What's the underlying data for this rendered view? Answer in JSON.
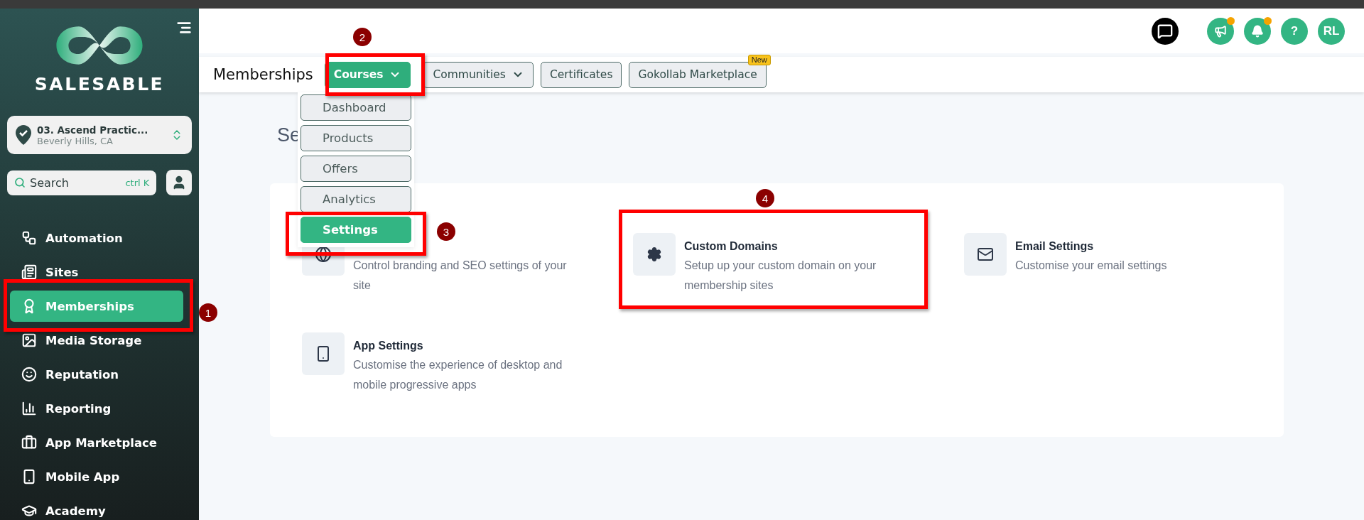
{
  "sidebar": {
    "logo": "SALESABLE",
    "location": {
      "name": "03. Ascend Practic...",
      "city": "Beverly Hills, CA"
    },
    "search": {
      "placeholder": "Search",
      "shortcut": "ctrl K"
    },
    "items": [
      {
        "label": "Automation",
        "selected": false
      },
      {
        "label": "Sites",
        "selected": false
      },
      {
        "label": "Memberships",
        "selected": true
      },
      {
        "label": "Media Storage",
        "selected": false
      },
      {
        "label": "Reputation",
        "selected": false
      },
      {
        "label": "Reporting",
        "selected": false
      },
      {
        "label": "App Marketplace",
        "selected": false
      },
      {
        "label": "Mobile App",
        "selected": false
      },
      {
        "label": "Academy",
        "selected": false
      }
    ]
  },
  "header": {
    "actions": [
      {
        "kind": "chat",
        "badge": false
      },
      {
        "kind": "megaphone",
        "badge": true
      },
      {
        "kind": "bell",
        "badge": true
      },
      {
        "kind": "help",
        "label": "?",
        "badge": false
      },
      {
        "kind": "avatar",
        "label": "RL",
        "badge": false
      }
    ]
  },
  "subnav": {
    "title": "Memberships",
    "tabs": [
      {
        "label": "Courses",
        "selected": true,
        "dropdown": true
      },
      {
        "label": "Communities",
        "selected": false,
        "dropdown": true
      },
      {
        "label": "Certificates",
        "selected": false,
        "dropdown": false
      },
      {
        "label": "Gokollab Marketplace",
        "selected": false,
        "dropdown": false,
        "badge": "New"
      }
    ]
  },
  "dropdown": {
    "items": [
      {
        "label": "Dashboard",
        "selected": false
      },
      {
        "label": "Products",
        "selected": false
      },
      {
        "label": "Offers",
        "selected": false
      },
      {
        "label": "Analytics",
        "selected": false
      },
      {
        "label": "Settings",
        "selected": true
      }
    ]
  },
  "page": {
    "title": "Se",
    "settings": [
      {
        "kind": "site",
        "description": "Control branding and SEO settings of your site"
      },
      {
        "kind": "domain",
        "title": "Custom Domains",
        "description": "Setup up your custom domain on your membership sites"
      },
      {
        "kind": "email",
        "title": "Email Settings",
        "description": "Customise your email settings"
      },
      {
        "kind": "app",
        "title": "App Settings",
        "description": "Customise the experience of desktop and mobile progressive apps"
      }
    ]
  },
  "annotations": [
    {
      "number": "1"
    },
    {
      "number": "2"
    },
    {
      "number": "3"
    },
    {
      "number": "4"
    }
  ]
}
